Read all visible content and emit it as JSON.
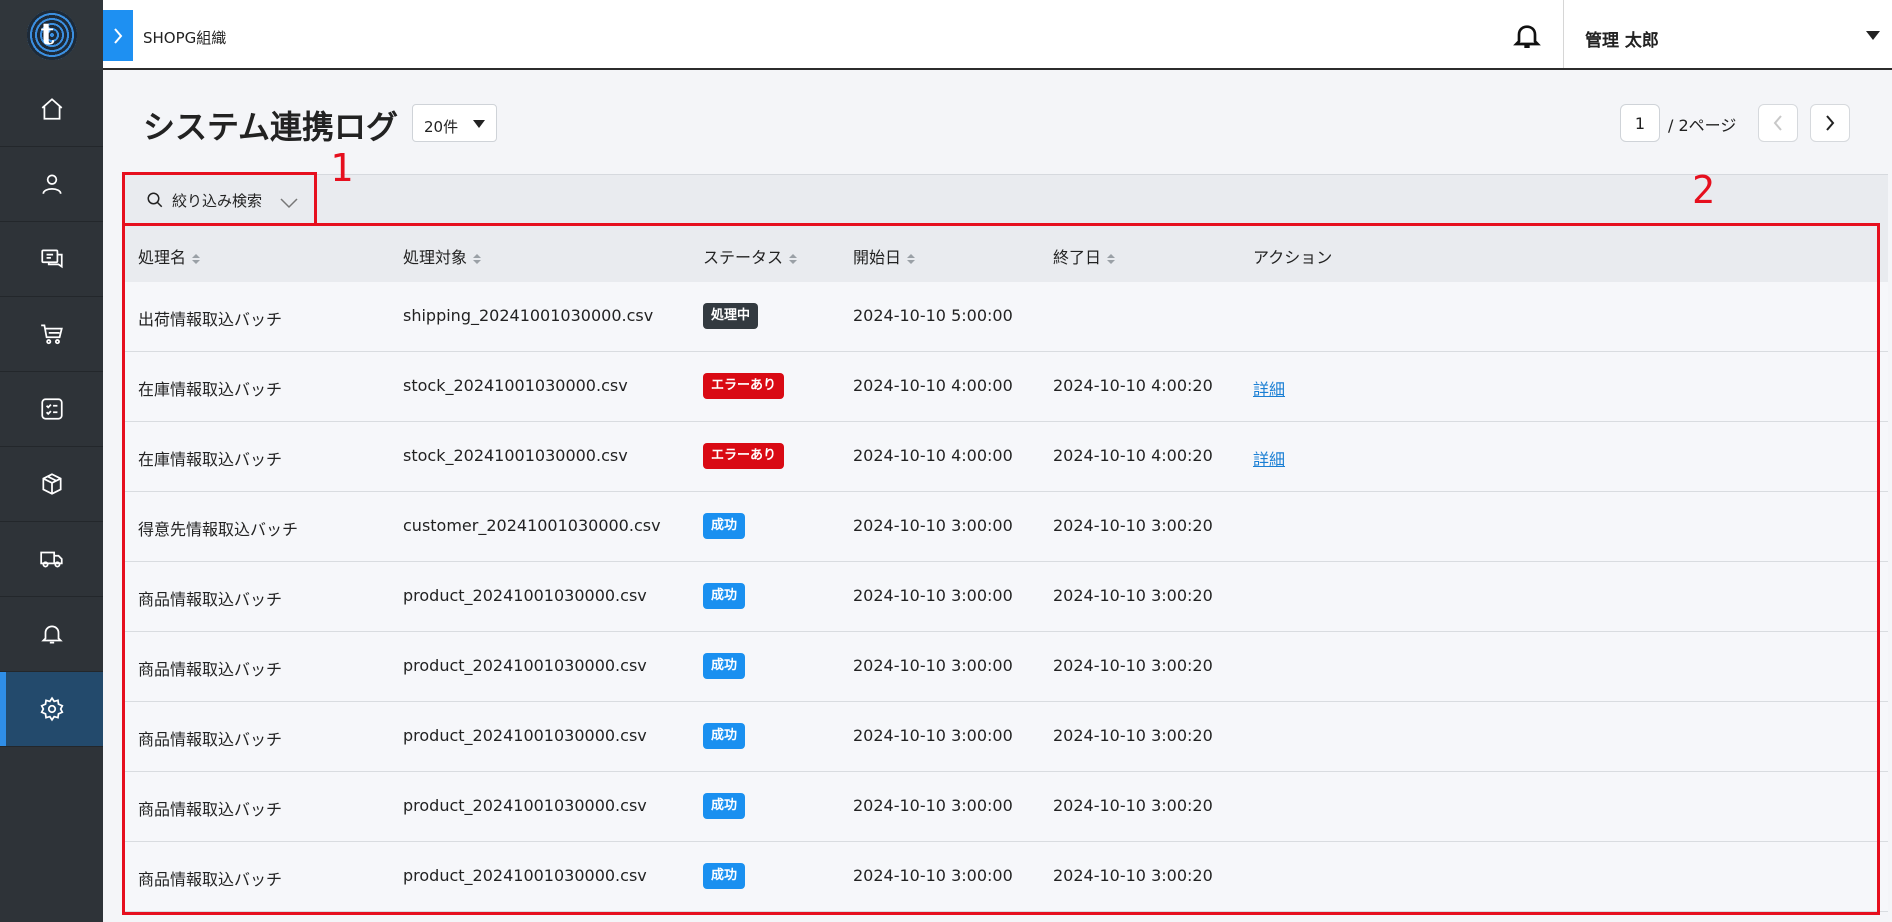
{
  "header": {
    "org_name": "SHOPG組織",
    "user_name": "管理 太郎"
  },
  "sidebar": {
    "items": [
      {
        "icon": "home-icon"
      },
      {
        "icon": "user-icon"
      },
      {
        "icon": "chat-icon"
      },
      {
        "icon": "cart-icon"
      },
      {
        "icon": "checklist-icon"
      },
      {
        "icon": "package-icon"
      },
      {
        "icon": "truck-icon"
      },
      {
        "icon": "bell-icon"
      },
      {
        "icon": "gear-icon",
        "active": true
      }
    ]
  },
  "page": {
    "title": "システム連携ログ",
    "per_page": "20件",
    "current_page": "1",
    "total_pages_label": "/ 2ページ"
  },
  "filter": {
    "label": "絞り込み検索"
  },
  "table": {
    "columns": [
      "処理名",
      "処理対象",
      "ステータス",
      "開始日",
      "終了日",
      "アクション"
    ],
    "rows": [
      {
        "name": "出荷情報取込バッチ",
        "target": "shipping_20241001030000.csv",
        "status": "処理中",
        "status_type": "processing",
        "start": "2024-10-10 5:00:00",
        "end": "",
        "action": ""
      },
      {
        "name": "在庫情報取込バッチ",
        "target": "stock_20241001030000.csv",
        "status": "エラーあり",
        "status_type": "error",
        "start": "2024-10-10 4:00:00",
        "end": "2024-10-10 4:00:20",
        "action": "詳細"
      },
      {
        "name": "在庫情報取込バッチ",
        "target": "stock_20241001030000.csv",
        "status": "エラーあり",
        "status_type": "error",
        "start": "2024-10-10 4:00:00",
        "end": "2024-10-10 4:00:20",
        "action": "詳細"
      },
      {
        "name": "得意先情報取込バッチ",
        "target": "customer_20241001030000.csv",
        "status": "成功",
        "status_type": "success",
        "start": "2024-10-10 3:00:00",
        "end": "2024-10-10 3:00:20",
        "action": ""
      },
      {
        "name": "商品情報取込バッチ",
        "target": "product_20241001030000.csv",
        "status": "成功",
        "status_type": "success",
        "start": "2024-10-10 3:00:00",
        "end": "2024-10-10 3:00:20",
        "action": ""
      },
      {
        "name": "商品情報取込バッチ",
        "target": "product_20241001030000.csv",
        "status": "成功",
        "status_type": "success",
        "start": "2024-10-10 3:00:00",
        "end": "2024-10-10 3:00:20",
        "action": ""
      },
      {
        "name": "商品情報取込バッチ",
        "target": "product_20241001030000.csv",
        "status": "成功",
        "status_type": "success",
        "start": "2024-10-10 3:00:00",
        "end": "2024-10-10 3:00:20",
        "action": ""
      },
      {
        "name": "商品情報取込バッチ",
        "target": "product_20241001030000.csv",
        "status": "成功",
        "status_type": "success",
        "start": "2024-10-10 3:00:00",
        "end": "2024-10-10 3:00:20",
        "action": ""
      },
      {
        "name": "商品情報取込バッチ",
        "target": "product_20241001030000.csv",
        "status": "成功",
        "status_type": "success",
        "start": "2024-10-10 3:00:00",
        "end": "2024-10-10 3:00:20",
        "action": ""
      }
    ]
  },
  "annotations": [
    {
      "label": "1"
    },
    {
      "label": "2"
    }
  ],
  "colors": {
    "accent": "#1a90f0",
    "error": "#d90a14",
    "processing": "#333a40",
    "annotation": "#e60f1e"
  }
}
